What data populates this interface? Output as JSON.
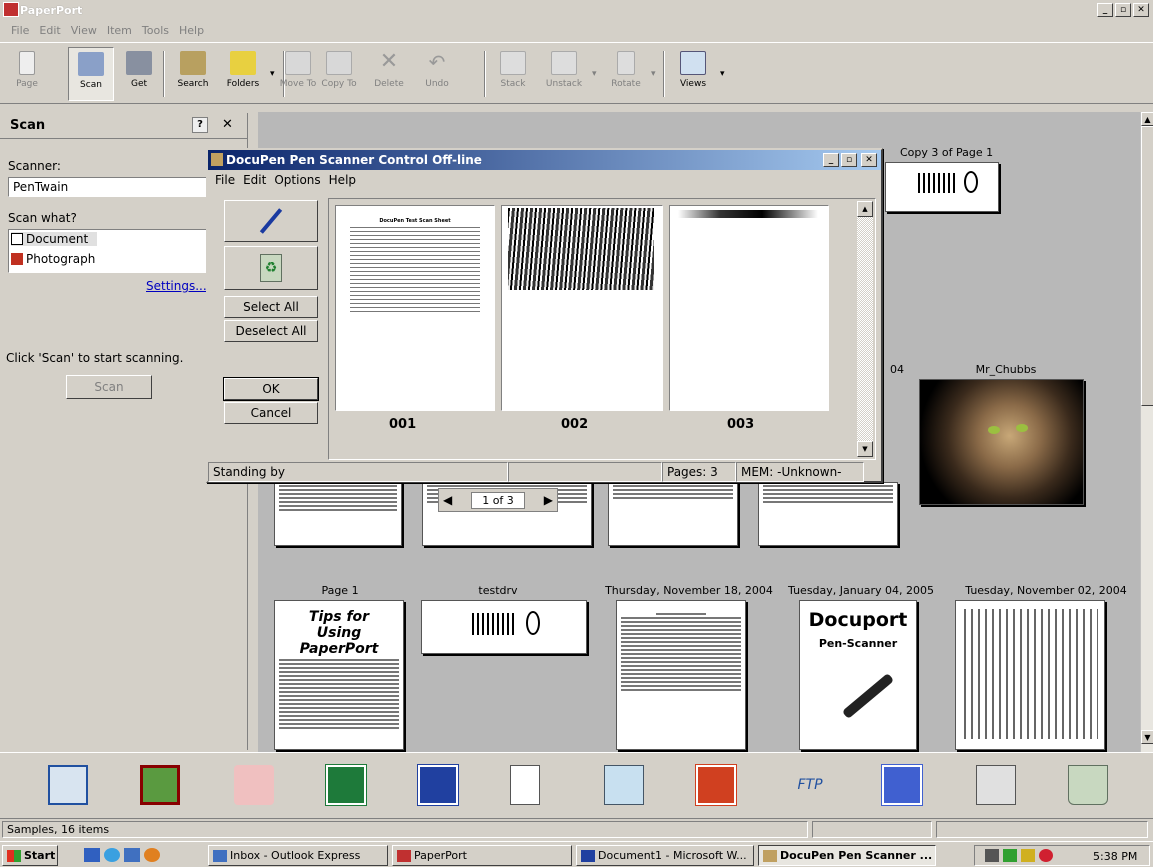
{
  "app": {
    "title": "PaperPort"
  },
  "menu": [
    "File",
    "Edit",
    "View",
    "Item",
    "Tools",
    "Help"
  ],
  "toolbar": {
    "page": "Page",
    "scan": "Scan",
    "get": "Get",
    "search": "Search",
    "folders": "Folders",
    "move_to": "Move To",
    "copy_to": "Copy To",
    "delete": "Delete",
    "undo": "Undo",
    "stack": "Stack",
    "unstack": "Unstack",
    "rotate": "Rotate",
    "views": "Views"
  },
  "scan_pane": {
    "title": "Scan",
    "scanner_label": "Scanner:",
    "scanner_value": "PenTwain",
    "scan_what_label": "Scan what?",
    "options": [
      "Document",
      "Photograph"
    ],
    "settings_link": "Settings...",
    "hint": "Click 'Scan' to start scanning.",
    "scan_button": "Scan"
  },
  "thumbnails": {
    "copy3": "Copy 3 of Page 1",
    "mr_chubbs": "Mr_Chubbs",
    "partial_04": "04",
    "page1": "Page 1",
    "testdrv": "testdrv",
    "thu_nov18": "Thursday, November 18, 2004",
    "tue_jan04": "Tuesday, January 04, 2005",
    "tue_nov02": "Tuesday, November 02, 2004",
    "stack_pager": "1 of 3",
    "tips_title": "Tips for Using PaperPort",
    "docuport_title": "Docuport",
    "docuport_sub": "Pen-Scanner"
  },
  "dialog": {
    "title": "DocuPen Pen Scanner Control Off-line",
    "menu": [
      "File",
      "Edit",
      "Options",
      "Help"
    ],
    "select_all": "Select All",
    "deselect_all": "Deselect All",
    "ok": "OK",
    "cancel": "Cancel",
    "pages": [
      "001",
      "002",
      "003"
    ],
    "page1_heading": "DocuPen Test Scan Sheet",
    "status": "Standing by",
    "pages_count": "Pages:   3",
    "mem": "MEM: -Unknown-"
  },
  "dock": [
    "send-to-mail-icon",
    "picture-icon",
    "art-tools-icon",
    "excel-icon",
    "word-icon",
    "notepad-icon",
    "notes-icon",
    "powerpoint-icon",
    "ftp-icon",
    "paperport-link-icon",
    "printer-icon",
    "recycle-icon"
  ],
  "status_bar": {
    "text": "Samples, 16 items"
  },
  "taskbar": {
    "start": "Start",
    "items": [
      "Inbox - Outlook Express",
      "PaperPort",
      "Document1 - Microsoft W...",
      "DocuPen Pen Scanner ..."
    ],
    "clock": "5:38 PM"
  }
}
